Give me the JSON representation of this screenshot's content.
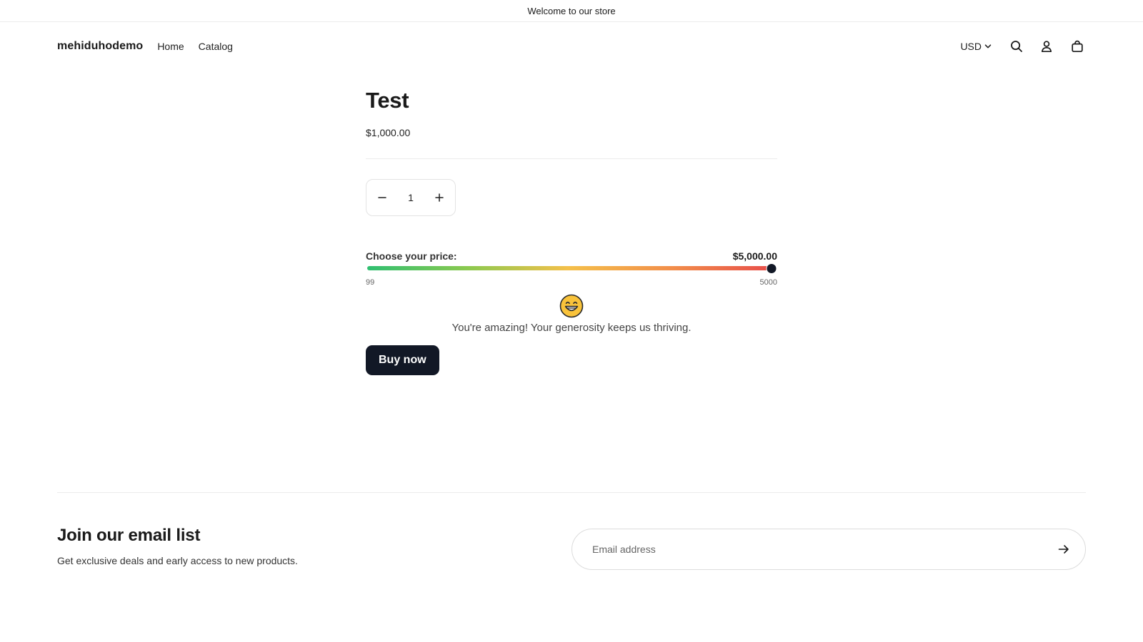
{
  "announcement": {
    "text": "Welcome to our store"
  },
  "header": {
    "logo": "mehiduhodemo",
    "nav": [
      {
        "label": "Home"
      },
      {
        "label": "Catalog"
      }
    ],
    "currency": "USD",
    "icons": [
      "search-icon",
      "account-icon",
      "cart-icon"
    ]
  },
  "product": {
    "title": "Test",
    "price": "$1,000.00",
    "quantity": "1"
  },
  "pay_what_you_want": {
    "label": "Choose your price:",
    "selected_display": "$5,000.00",
    "min": "99",
    "max": "5000",
    "selected_value": 5000,
    "emoji": "grinning-face-icon",
    "message": "You're amazing! Your generosity keeps us thriving.",
    "gradient_colors": [
      "#2fbf71",
      "#8bc94f",
      "#f4c04a",
      "#f2904a",
      "#e8504a"
    ]
  },
  "buy_button": {
    "label": "Buy now"
  },
  "newsletter": {
    "title": "Join our email list",
    "subtitle": "Get exclusive deals and early access to new products.",
    "email_placeholder": "Email address"
  },
  "colors": {
    "primary_dark": "#121826",
    "border": "#e3e3e3"
  }
}
